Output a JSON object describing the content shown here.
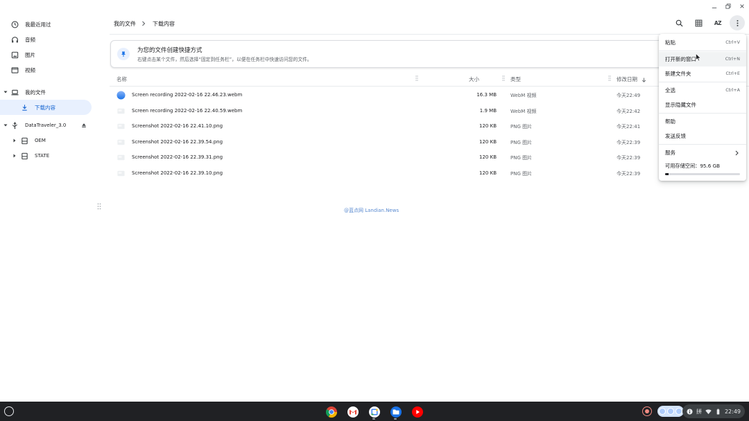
{
  "window": {
    "minimize": "minimize",
    "restore": "restore",
    "close": "close"
  },
  "sidebar": {
    "items": [
      {
        "label": "我最近用过",
        "icon": "clock-icon"
      },
      {
        "label": "音频",
        "icon": "headphones-icon"
      },
      {
        "label": "图片",
        "icon": "image-icon"
      },
      {
        "label": "视频",
        "icon": "video-icon"
      }
    ],
    "my_files": "我的文件",
    "downloads": "下载内容",
    "usb": "DataTraveler_3.0",
    "partitions": [
      "OEM",
      "STATE"
    ]
  },
  "breadcrumb": {
    "root": "我的文件",
    "current": "下载内容"
  },
  "toolbar": {
    "sort_label": "AZ"
  },
  "banner": {
    "title": "为您的文件创建快捷方式",
    "subtitle": "右键点击某个文件，然后选择“固定到任务栏”，以便在任务栏中快速访问您的文件。"
  },
  "columns": {
    "name": "名称",
    "size": "大小",
    "type": "类型",
    "date": "修改日期"
  },
  "files": [
    {
      "name": "Screen recording 2022-02-16 22.46.23.webm",
      "size": "16.3 MB",
      "type": "WebM 视频",
      "date": "今天22:49",
      "icon": "video-file-icon"
    },
    {
      "name": "Screen recording 2022-02-16 22.40.59.webm",
      "size": "1.9 MB",
      "type": "WebM 视频",
      "date": "今天22:42",
      "icon": "video-file-icon"
    },
    {
      "name": "Screenshot 2022-02-16 22.41.10.png",
      "size": "120 KB",
      "type": "PNG 图片",
      "date": "今天22:41",
      "icon": "image-file-icon"
    },
    {
      "name": "Screenshot 2022-02-16 22.39.54.png",
      "size": "120 KB",
      "type": "PNG 图片",
      "date": "今天22:39",
      "icon": "image-file-icon"
    },
    {
      "name": "Screenshot 2022-02-16 22.39.31.png",
      "size": "120 KB",
      "type": "PNG 图片",
      "date": "今天22:39",
      "icon": "image-file-icon"
    },
    {
      "name": "Screenshot 2022-02-16 22.39.10.png",
      "size": "120 KB",
      "type": "PNG 图片",
      "date": "今天22:39",
      "icon": "image-file-icon"
    }
  ],
  "watermark": "@蓝点网 Landian.News",
  "menu": {
    "paste": {
      "label": "粘贴",
      "shortcut": "Ctrl+V"
    },
    "new_window": {
      "label": "打开新的窗口",
      "shortcut": "Ctrl+N"
    },
    "new_folder": {
      "label": "新建文件夹",
      "shortcut": "Ctrl+E"
    },
    "select_all": {
      "label": "全选",
      "shortcut": "Ctrl+A"
    },
    "show_hidden": {
      "label": "显示隐藏文件"
    },
    "help": {
      "label": "帮助"
    },
    "feedback": {
      "label": "发送反馈"
    },
    "services": {
      "label": "服务"
    },
    "storage": {
      "label": "可用存储空间：95.6 GB",
      "used_fraction": 0.05
    }
  },
  "shelf": {
    "apps": [
      "chrome-icon",
      "gmail-icon",
      "calendar-icon",
      "files-icon",
      "youtube-icon"
    ],
    "ime": "拼",
    "time": "22:49"
  },
  "colors": {
    "accent": "#1a73e8",
    "active_bg": "#e8f0fe",
    "shelf": "#202124"
  }
}
